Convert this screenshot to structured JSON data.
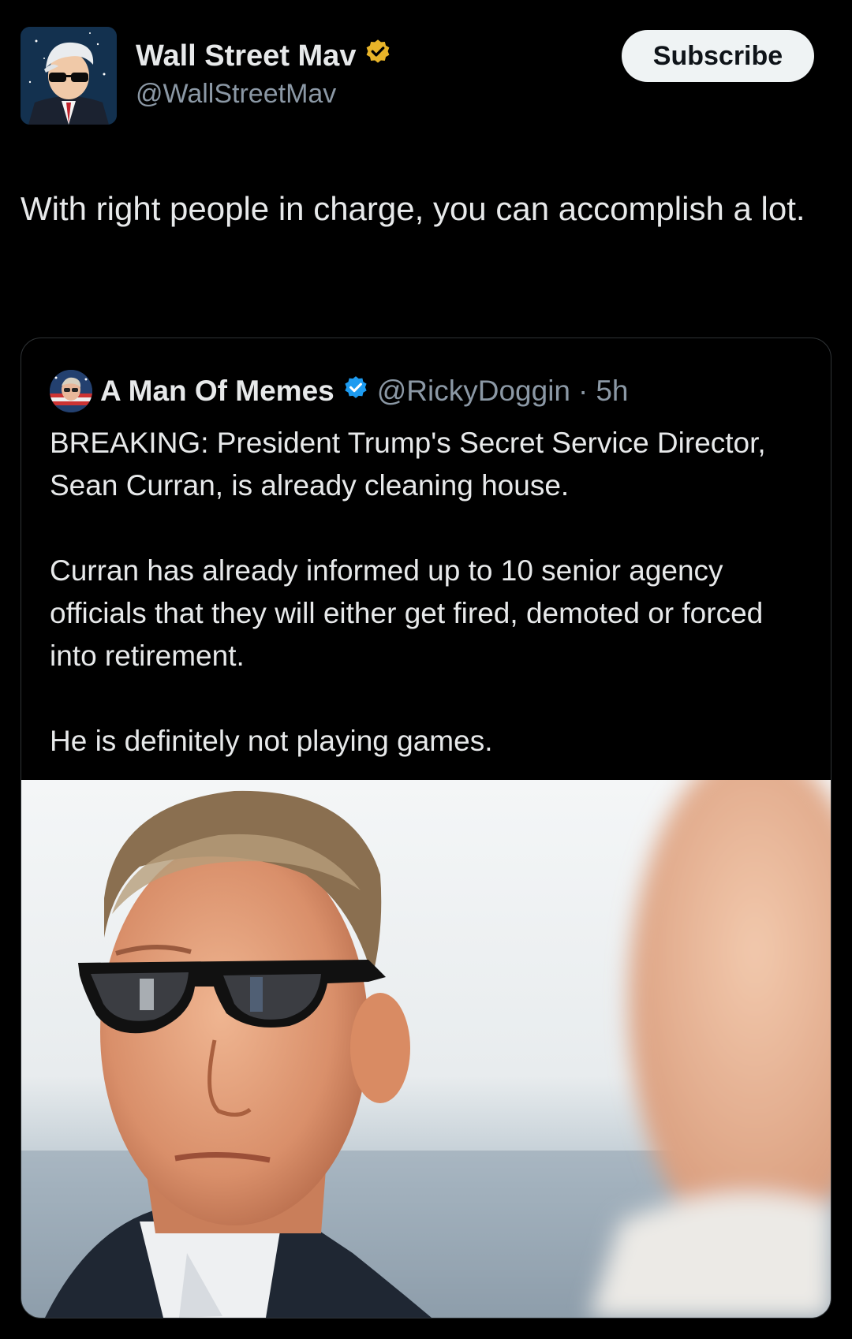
{
  "header": {
    "author_name": "Wall Street Mav",
    "author_handle": "@WallStreetMav",
    "subscribe_label": "Subscribe"
  },
  "tweet": {
    "text": "With right people in charge, you can accomplish a lot."
  },
  "quoted": {
    "name": "A Man Of Memes",
    "handle": "@RickyDoggin",
    "separator": "·",
    "time": "5h",
    "body": "BREAKING: President Trump's Secret Service Director, Sean Curran, is already cleaning house.\n\nCurran has already informed up to 10 senior agency officials that they will either get fired, demoted or forced into retirement.\n\nHe is definitely not playing games."
  },
  "colors": {
    "background": "#000000",
    "text": "#e7e9ea",
    "secondary": "#8b98a5",
    "gold_verified": "#e8b429",
    "blue_verified": "#1d9bf0",
    "subscribe_bg": "#eff3f4"
  },
  "icons": [
    "avatar-image",
    "gold-verified-icon",
    "blue-verified-icon",
    "quoted-avatar-image",
    "quoted-photo"
  ]
}
